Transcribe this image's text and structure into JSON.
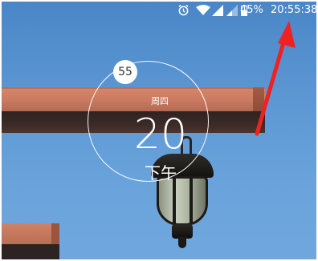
{
  "status_bar": {
    "battery_percent": "45%",
    "time": "20:55:38",
    "icons": [
      "alarm-icon",
      "wifi-icon",
      "cell-signal-icon",
      "cell-signal-icon",
      "battery-icon"
    ]
  },
  "clock_widget": {
    "seconds": "55",
    "weekday": "周四",
    "hour": "20",
    "period": "下午"
  },
  "colors": {
    "sky": "#5b96d3",
    "beam": "#c97a60",
    "annotation_arrow": "#ee2222",
    "widget_text": "#ffffff"
  }
}
